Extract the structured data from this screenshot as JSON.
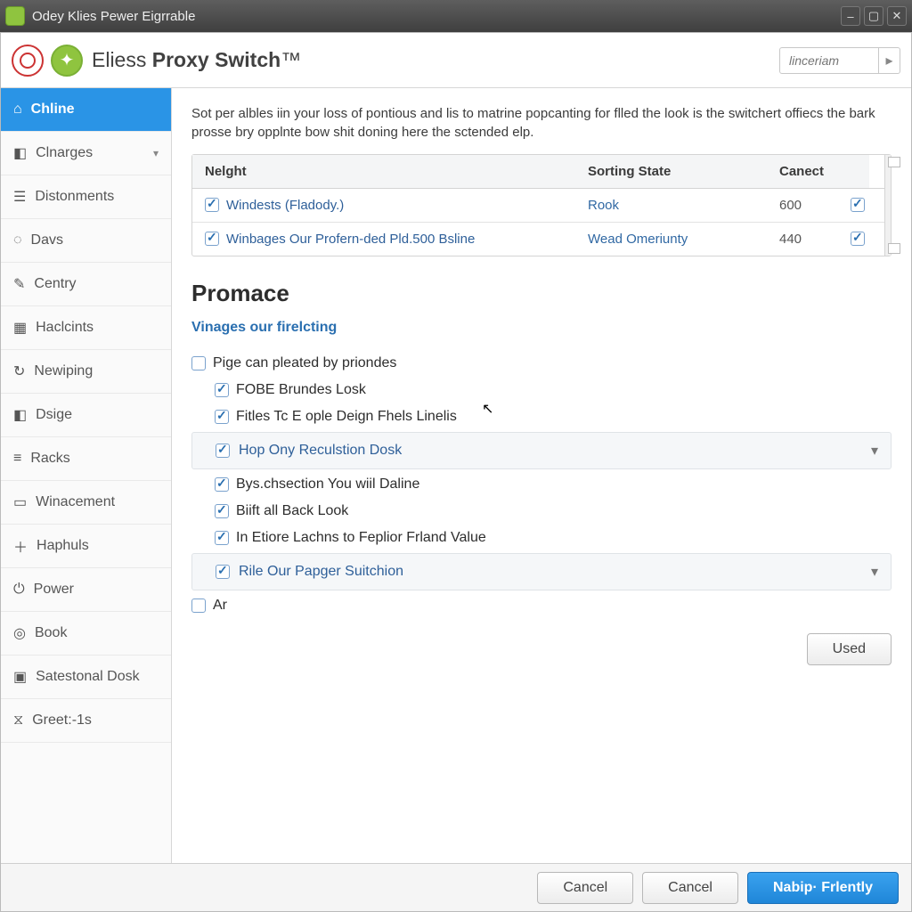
{
  "titlebar": {
    "title": "Odey Klies Pewer Eigrrable"
  },
  "brand": {
    "name_prefix": "Eliess ",
    "name_bold": "Proxy Switch",
    "search_placeholder": "linceriam"
  },
  "sidebar": {
    "items": [
      {
        "label": "Chline",
        "active": true
      },
      {
        "label": "Clnarges",
        "expandable": true
      },
      {
        "label": "Distonments"
      },
      {
        "label": "Davs"
      },
      {
        "label": "Centry"
      },
      {
        "label": "Haclcints"
      },
      {
        "label": "Newiping"
      },
      {
        "label": "Dsige"
      },
      {
        "label": "Racks"
      },
      {
        "label": "Winacement"
      },
      {
        "label": "Haphuls"
      },
      {
        "label": "Power"
      },
      {
        "label": "Book"
      },
      {
        "label": "Satestonal Dosk"
      },
      {
        "label": "Greet:-1s"
      }
    ]
  },
  "intro": "Sot per albles iin your loss of pontious and lis to matrine popcanting for flled the look is the switchert offiecs the bark prosse bry opplnte bow shit doning here the sctended elp.",
  "table": {
    "headers": {
      "c1": "Nelght",
      "c2": "Sorting State",
      "c3": "Canect"
    },
    "rows": [
      {
        "name": "Windests (Fladody.)",
        "state": "Rook",
        "canect": "600"
      },
      {
        "name": "Winbages Our Profern-ded Pld.500 Bsline",
        "state": "Wead Omeriunty",
        "canect": "440"
      }
    ]
  },
  "section": {
    "heading": "Promace",
    "sublink": "Vinages our firelcting",
    "opt_top": "Pige can pleated by priondes",
    "opts": [
      {
        "label": "FOBE Brundes Losk"
      },
      {
        "label": "Fitles Tc E ople Deign Fhels Linelis"
      }
    ],
    "expand1": "Hop Ony Reculstion Dosk",
    "opts2": [
      {
        "label": "Bys.chsection You wiil Daline"
      },
      {
        "label": "Biift all Back Look"
      },
      {
        "label": "In Etiore Lachns to Feplior Frland Value"
      }
    ],
    "expand2": "Rile Our Papger Suitchion",
    "opt_bottom": "Ar",
    "used_btn": "Used"
  },
  "footer": {
    "cancel1": "Cancel",
    "cancel2": "Cancel",
    "primary": "Nabip· Frlently"
  }
}
